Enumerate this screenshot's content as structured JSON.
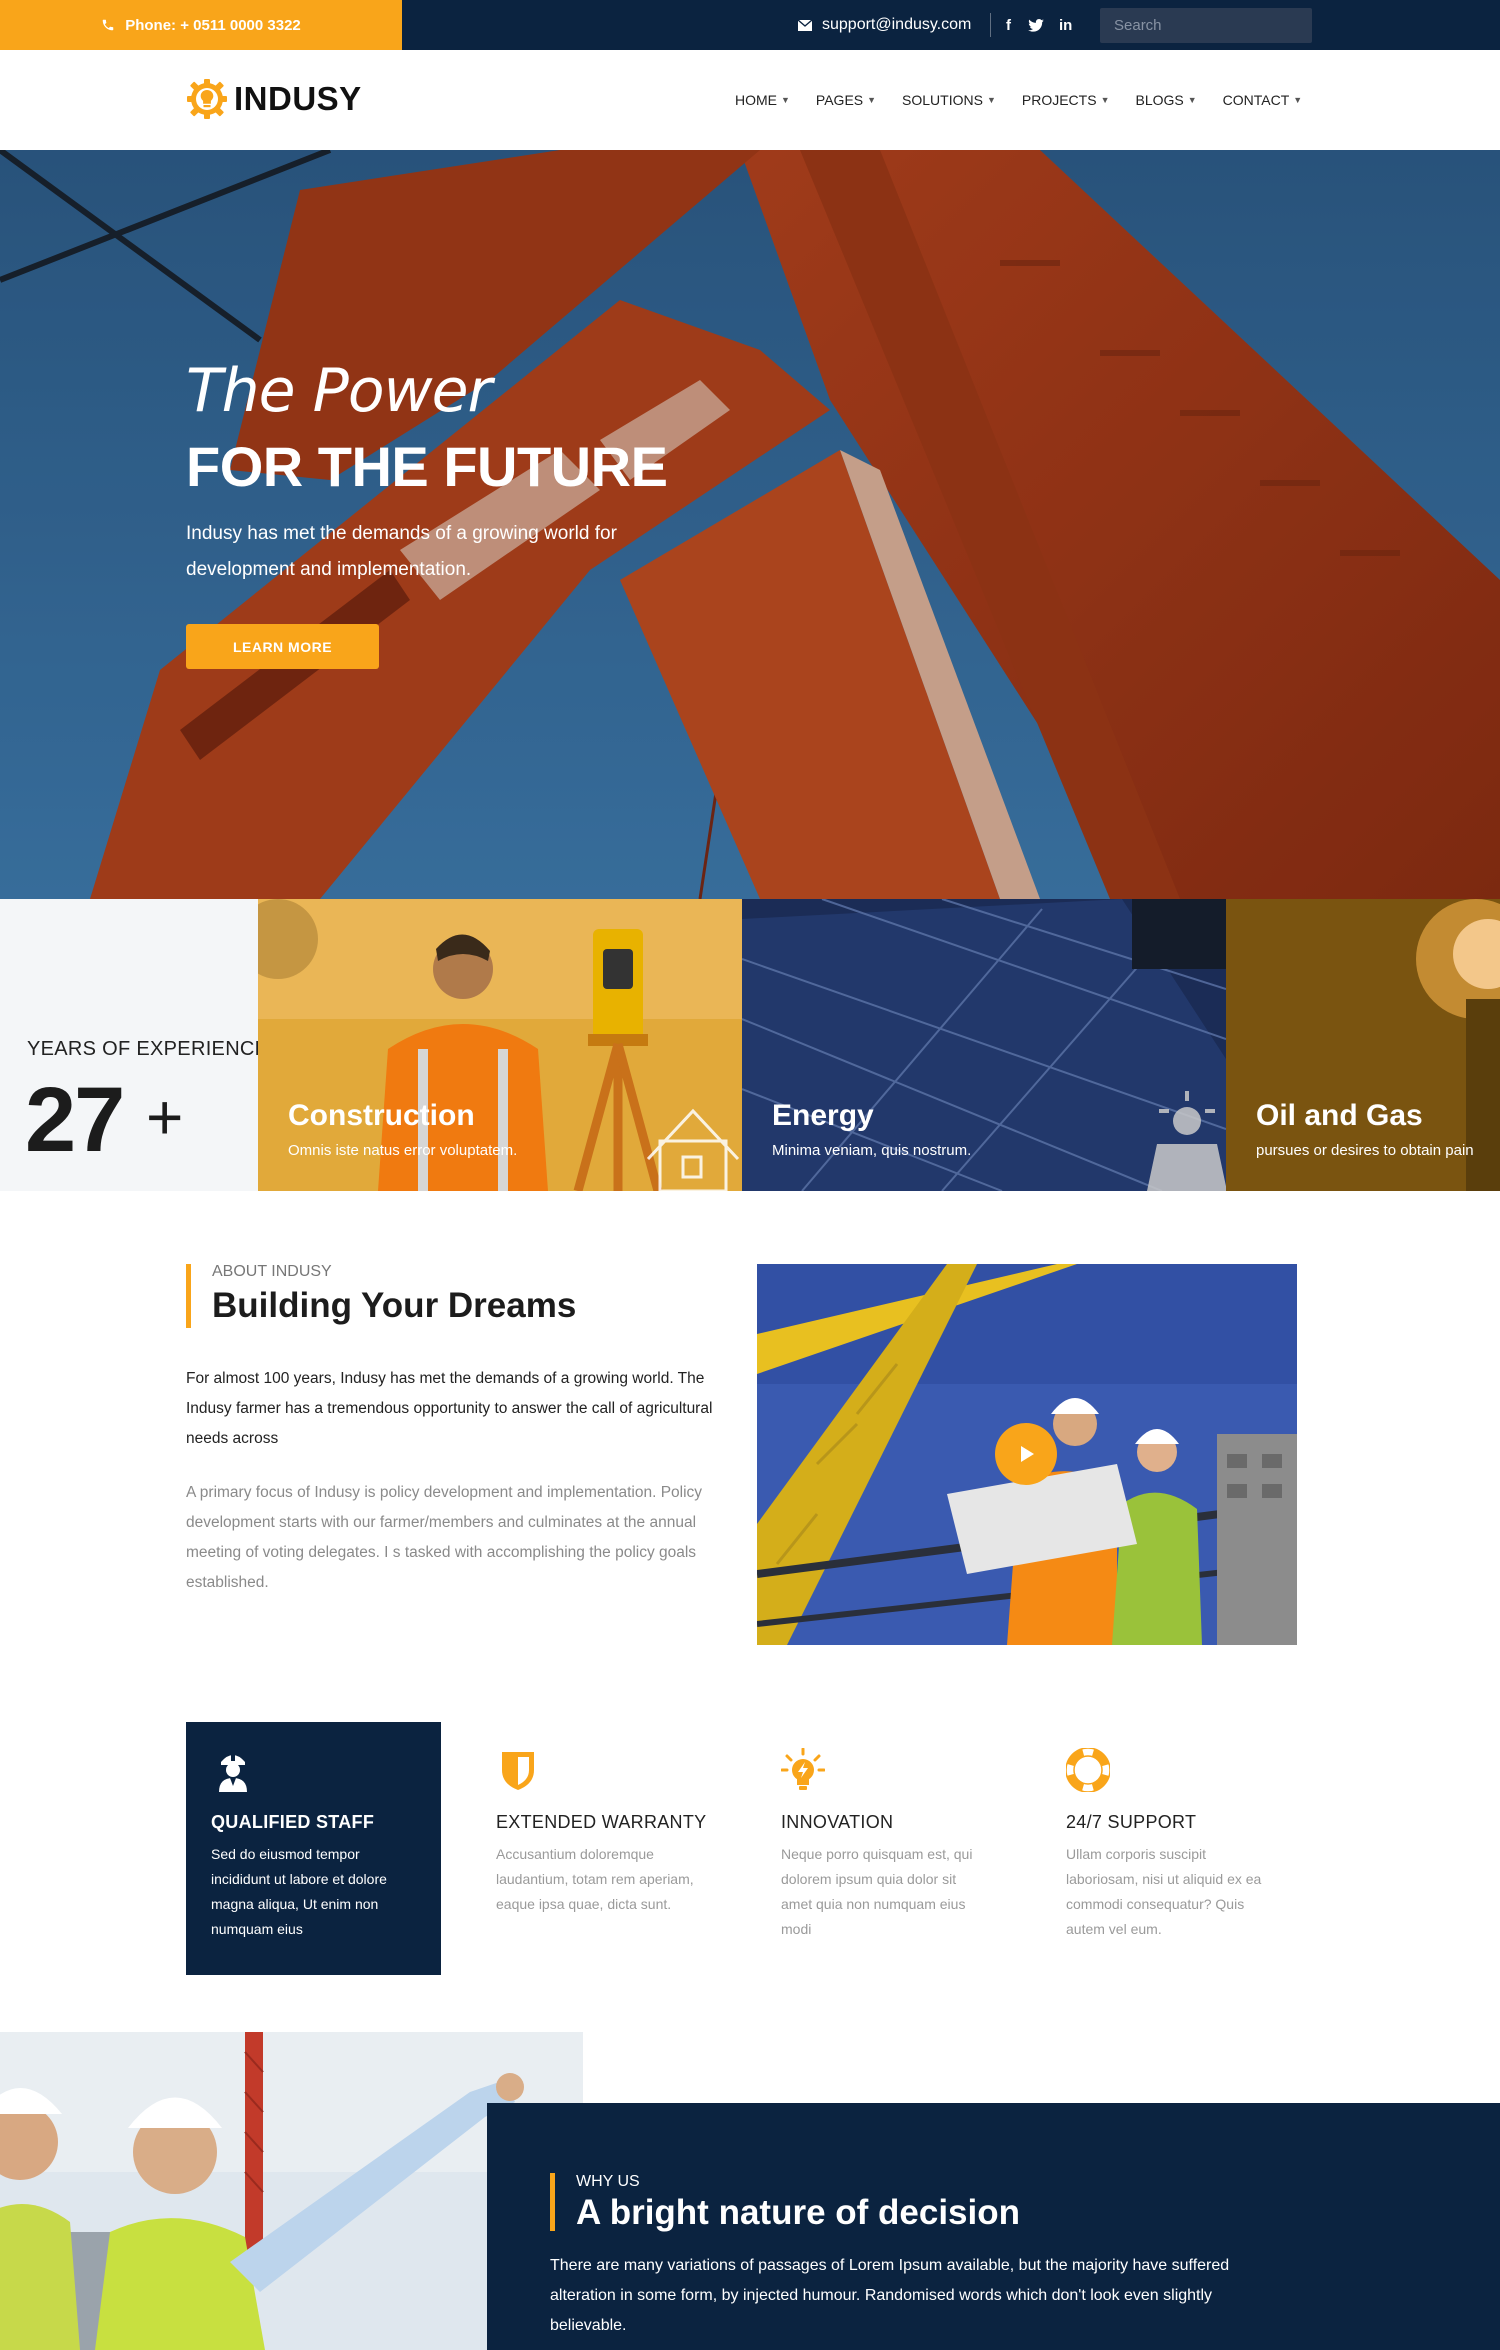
{
  "topbar": {
    "phone": "Phone: + 0511 0000 3322",
    "email": "support@indusy.com",
    "social": [
      "f",
      "twitter-icon",
      "in"
    ],
    "search_placeholder": "Search"
  },
  "brand": {
    "name": "INDUSY",
    "accent": "#f9a51a",
    "navy": "#0b2340"
  },
  "nav": {
    "items": [
      "HOME",
      "PAGES",
      "SOLUTIONS",
      "PROJECTS",
      "BLOGS",
      "CONTACT"
    ]
  },
  "hero": {
    "title_line1": "The Power",
    "title_line2": "FOR THE FUTURE",
    "description": "Indusy has met the demands of a growing world for development and implementation.",
    "button": "LEARN MORE"
  },
  "experience": {
    "label": "YEARS OF EXPERIENCE",
    "number": "27",
    "suffix": "+"
  },
  "services": [
    {
      "title": "Construction",
      "subtitle": "Omnis iste natus error voluptatem."
    },
    {
      "title": "Energy",
      "subtitle": "Minima veniam, quis nostrum."
    },
    {
      "title": "Oil and Gas",
      "subtitle": "pursues or desires to obtain pain"
    }
  ],
  "about": {
    "kicker": "ABOUT INDUSY",
    "title": "Building Your Dreams",
    "paragraph1": "For almost 100 years, Indusy has met the demands of a growing world. The Indusy farmer has a tremendous opportunity to answer the call of agricultural needs across",
    "paragraph2": "A primary focus of Indusy is policy development and implementation. Policy development starts with our farmer/members and culminates at the annual meeting of voting delegates. I s tasked with accomplishing the policy goals established."
  },
  "features": [
    {
      "icon": "worker-icon",
      "title": "QUALIFIED STAFF",
      "text": "Sed do eiusmod tempor incididunt ut labore et dolore magna aliqua, Ut enim non numquam eius"
    },
    {
      "icon": "shield-icon",
      "title": "EXTENDED WARRANTY",
      "text": "Accusantium doloremque laudantium, totam rem aperiam, eaque ipsa quae, dicta sunt."
    },
    {
      "icon": "lightbulb-icon",
      "title": "INNOVATION",
      "text": "Neque porro quisquam est, qui dolorem ipsum quia dolor sit amet quia non numquam eius modi"
    },
    {
      "icon": "lifebuoy-icon",
      "title": "24/7 SUPPORT",
      "text": "Ullam corporis suscipit laboriosam, nisi ut aliquid ex ea commodi consequatur? Quis autem vel eum."
    }
  ],
  "why": {
    "kicker": "WHY US",
    "title": "A bright nature of decision",
    "text": "There are many variations of passages of Lorem Ipsum available, but the majority have suffered alteration in some form, by injected humour. Randomised words which don't look even slightly believable."
  }
}
